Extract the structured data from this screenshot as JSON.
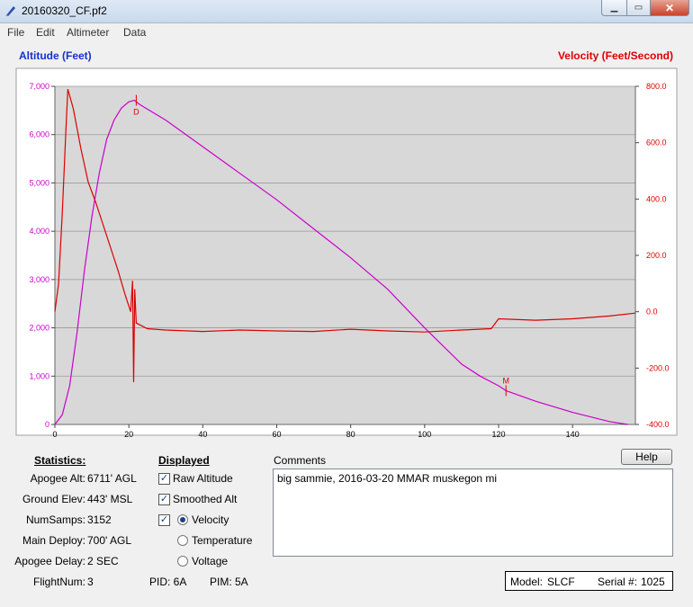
{
  "window": {
    "title": "20160320_CF.pf2"
  },
  "menu": [
    "File",
    "Edit",
    "Altimeter",
    "Data"
  ],
  "colors": {
    "altitude": "#cc00cc",
    "velocity": "#dd0000",
    "left_axis_title": "#1530cc",
    "right_axis_title": "#dd0000",
    "plot_bg": "#d8d8d8"
  },
  "chart": {
    "left_title": "Altitude (Feet)",
    "right_title": "Velocity (Feet/Second)",
    "left_ticks": [
      "7,000",
      "6,000",
      "5,000",
      "4,000",
      "3,000",
      "2,000",
      "1,000",
      "0"
    ],
    "right_ticks": [
      "800.0",
      "600.0",
      "400.0",
      "200.0",
      "0.0",
      "-200.0",
      "-400.0"
    ],
    "x_ticks": [
      "0",
      "20",
      "40",
      "60",
      "80",
      "100",
      "120",
      "140"
    ],
    "marker_d": "D",
    "marker_m": "M"
  },
  "chart_data": {
    "type": "line",
    "xlim": [
      0,
      157
    ],
    "ylim_left": [
      0,
      7000
    ],
    "ylim_right": [
      -400,
      800
    ],
    "grid": true,
    "series": [
      {
        "name": "Altitude (Feet)",
        "axis": "left",
        "x": [
          0,
          2,
          4,
          6,
          8,
          10,
          12,
          14,
          16,
          18,
          20,
          21.5,
          23,
          30,
          40,
          50,
          60,
          70,
          80,
          90,
          100,
          110,
          115,
          120,
          122,
          130,
          140,
          150,
          155
        ],
        "y": [
          0,
          200,
          800,
          1900,
          3200,
          4300,
          5200,
          5900,
          6300,
          6550,
          6680,
          6711,
          6620,
          6300,
          5750,
          5200,
          4650,
          4050,
          3450,
          2800,
          2000,
          1250,
          1000,
          800,
          700,
          480,
          250,
          60,
          0
        ]
      },
      {
        "name": "Velocity (Feet/Second)",
        "axis": "right",
        "x": [
          0,
          1,
          2,
          3,
          3.5,
          5,
          7,
          9,
          11,
          13,
          15,
          17,
          19,
          20.5,
          21,
          21.3,
          21.6,
          22,
          25,
          30,
          40,
          50,
          60,
          70,
          80,
          90,
          100,
          110,
          118,
          120,
          130,
          140,
          150,
          157
        ],
        "y": [
          0,
          100,
          350,
          650,
          790,
          720,
          580,
          460,
          390,
          310,
          230,
          150,
          60,
          0,
          110,
          -250,
          80,
          -40,
          -60,
          -65,
          -70,
          -65,
          -68,
          -70,
          -62,
          -68,
          -72,
          -65,
          -60,
          -25,
          -30,
          -25,
          -15,
          -5
        ]
      }
    ],
    "annotations": [
      {
        "text": "D",
        "x": 22,
        "y": 6711,
        "axis": "left"
      },
      {
        "text": "M",
        "x": 122,
        "y": 700,
        "axis": "left"
      }
    ]
  },
  "panel": {
    "statistics_title": "Statistics:",
    "displayed_title": "Displayed",
    "comments_label": "Comments",
    "help_label": "Help",
    "stats": [
      {
        "label": "Apogee Alt:",
        "value": "6711' AGL"
      },
      {
        "label": "Ground Elev:",
        "value": "443' MSL"
      },
      {
        "label": "NumSamps:",
        "value": "3152"
      },
      {
        "label": "Main Deploy:",
        "value": "700' AGL"
      },
      {
        "label": "Apogee Delay:",
        "value": "2 SEC"
      },
      {
        "label": "FlightNum:",
        "value": "3"
      }
    ],
    "displayed": {
      "raw_altitude": "Raw Altitude",
      "smoothed_alt": "Smoothed Alt",
      "velocity": "Velocity",
      "temperature": "Temperature",
      "voltage": "Voltage"
    },
    "pid": "PID: 6A",
    "pim": "PIM: 5A",
    "comment_text": "big sammie, 2016-03-20 MMAR muskegon mi",
    "model_label": "Model:",
    "model_value": "SLCF",
    "serial_label": "Serial #:",
    "serial_value": "1025"
  }
}
